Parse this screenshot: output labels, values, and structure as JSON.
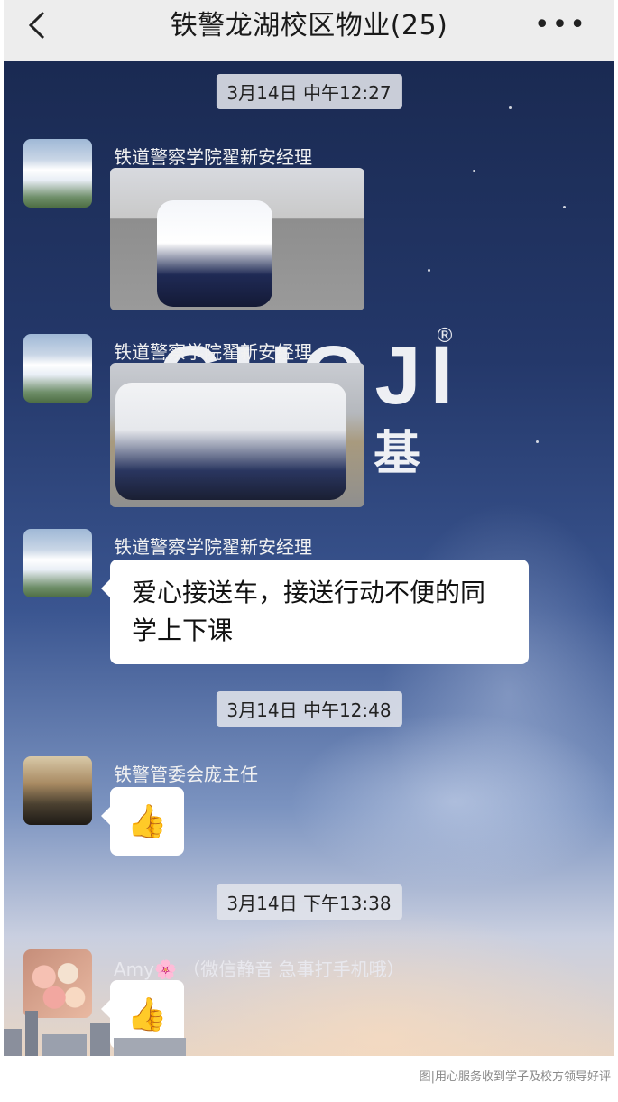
{
  "header": {
    "title": "铁警龙湖校区物业(25)",
    "back_icon": "chevron-left-icon",
    "more_icon": "more-dots-icon"
  },
  "messages": {
    "time1": "3月14日 中午12:27",
    "sender1": "铁道警察学院翟新安经理",
    "sender2": "铁道警察学院翟新安经理",
    "sender3": "铁道警察学院翟新安经理",
    "text3": "爱心接送车，接送行动不便的同学上下课",
    "time2": "3月14日 中午12:48",
    "sender4": "铁警管委会庞主任",
    "emoji4": "👍",
    "time3": "3月14日 下午13:38",
    "sender5": "Amy🌸 （微信静音 急事打手机哦）",
    "emoji5": "👍"
  },
  "watermark": {
    "latin": "GUOJI",
    "registered": "®",
    "chinese": "基"
  },
  "caption": "图|用心服务收到学子及校方领导好评",
  "colors": {
    "header_bg": "#ededed",
    "bubble_bg": "#ffffff",
    "chat_bg_top": "#1a2a52"
  }
}
